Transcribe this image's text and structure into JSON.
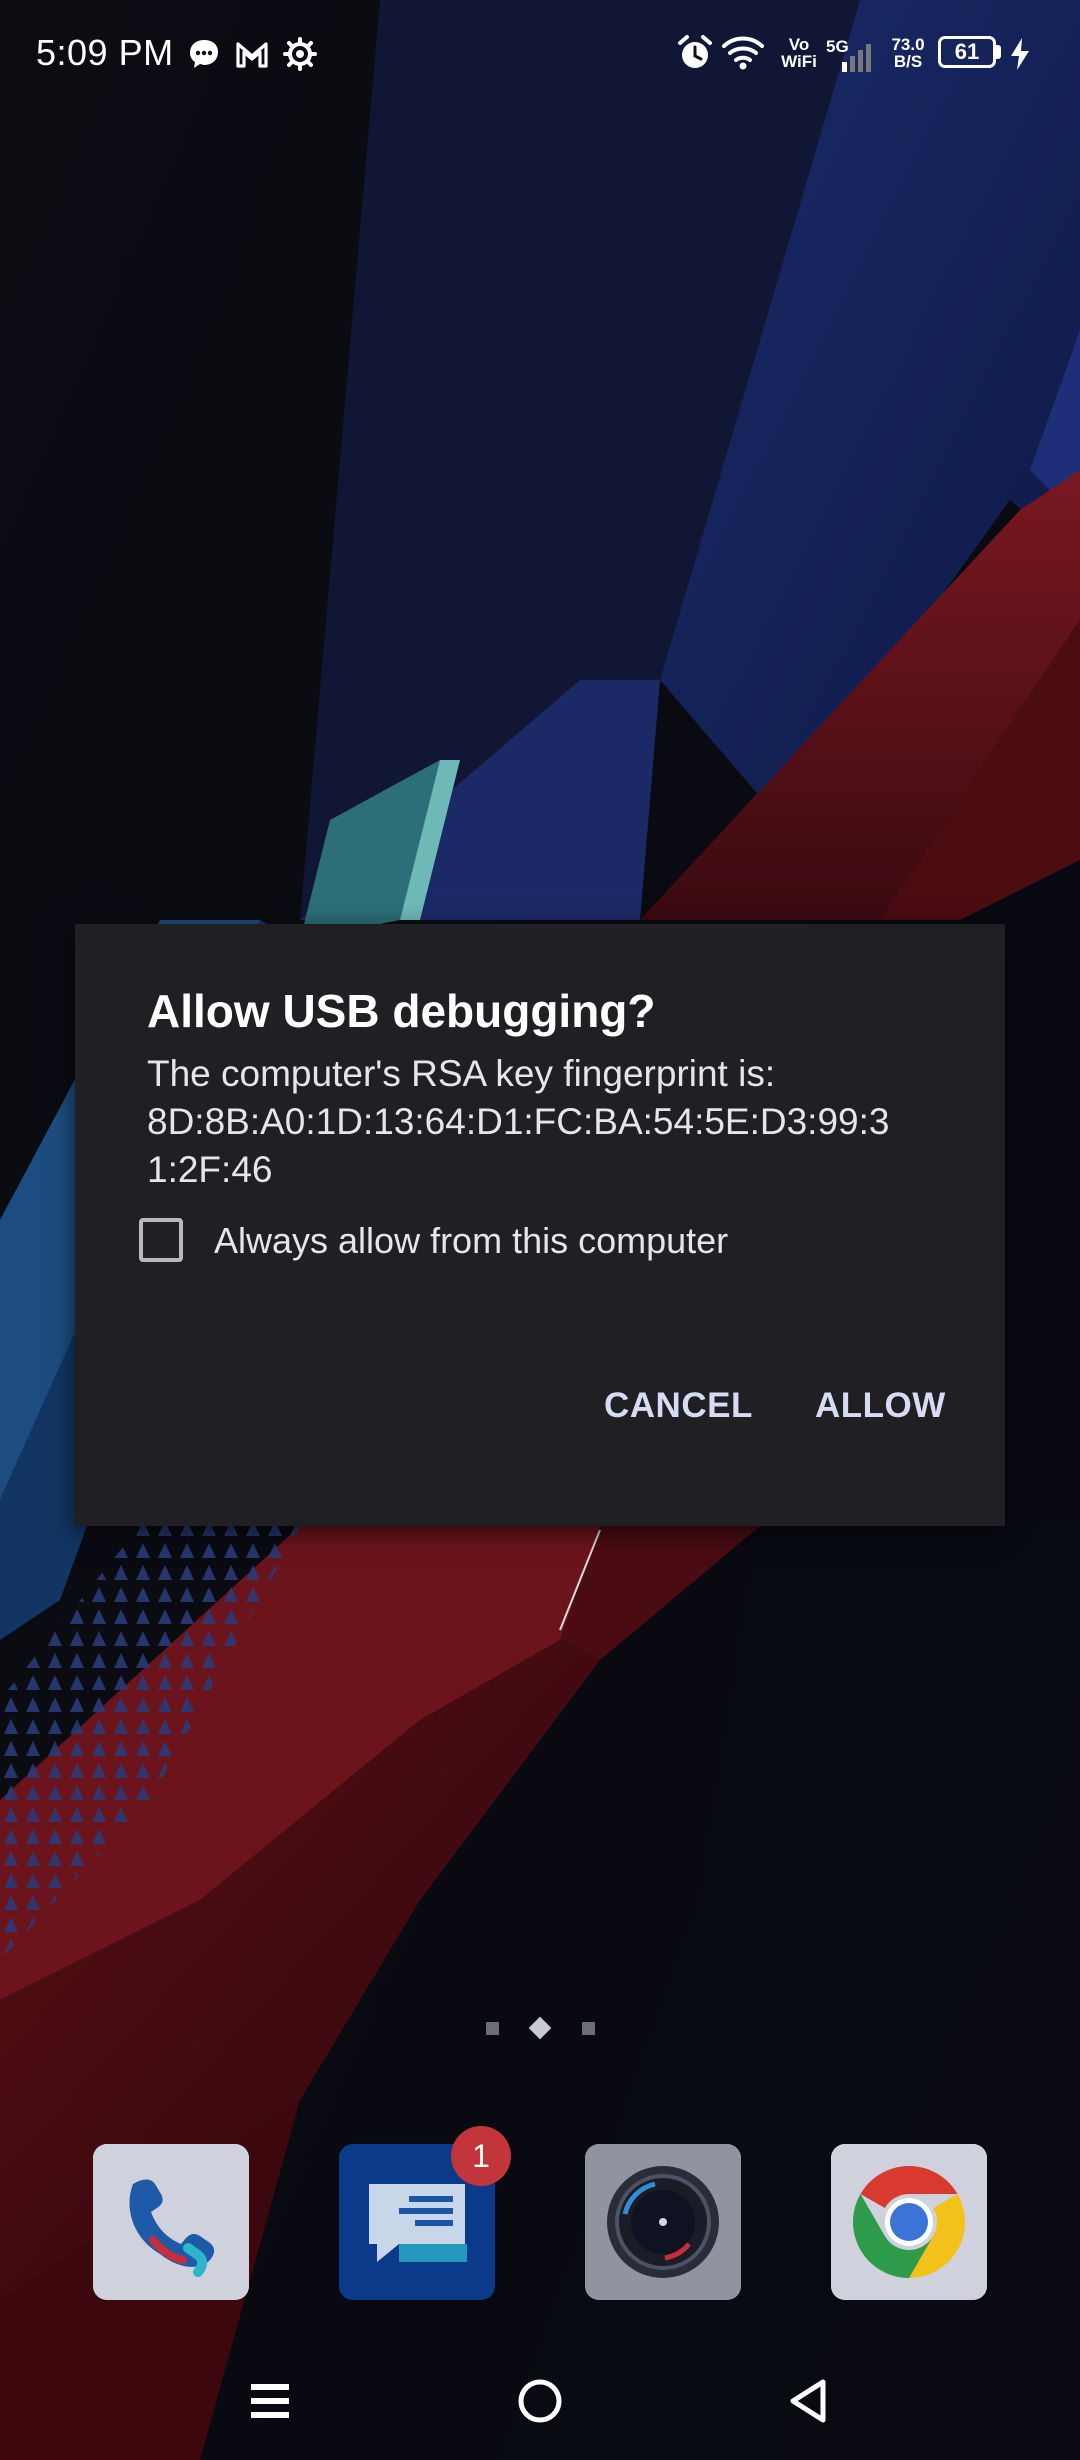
{
  "status_bar": {
    "time": "5:09 PM",
    "notification_icons": [
      "chat-bubble-icon",
      "gmail-icon",
      "settings-gear-icon"
    ],
    "vowifi_top": "Vo",
    "vowifi_bottom": "WiFi",
    "network": "5G",
    "speed_value": "73.0",
    "speed_unit": "B/S",
    "battery_level": "61"
  },
  "dialog": {
    "title": "Allow USB debugging?",
    "message_line1": "The computer's RSA key fingerprint is:",
    "fingerprint_line1": "8D:8B:A0:1D:13:64:D1:FC:BA:54:5E:D3:99:3",
    "fingerprint_line2": "1:2F:46",
    "checkbox_label": "Always allow from this computer",
    "checkbox_checked": false,
    "cancel_label": "CANCEL",
    "allow_label": "ALLOW"
  },
  "home": {
    "page_count": 3,
    "active_page": 1,
    "dock": [
      {
        "name": "phone-app",
        "icon": "phone-icon"
      },
      {
        "name": "messages-app",
        "icon": "message-icon",
        "badge": "1"
      },
      {
        "name": "camera-app",
        "icon": "camera-icon"
      },
      {
        "name": "chrome-app",
        "icon": "chrome-icon"
      }
    ]
  },
  "navigation": {
    "buttons": [
      "menu-icon",
      "home-icon",
      "back-icon"
    ]
  },
  "colors": {
    "dialog_bg": "#1f1f24",
    "button_text": "#d7dcf4",
    "badge": "#c2353a"
  }
}
